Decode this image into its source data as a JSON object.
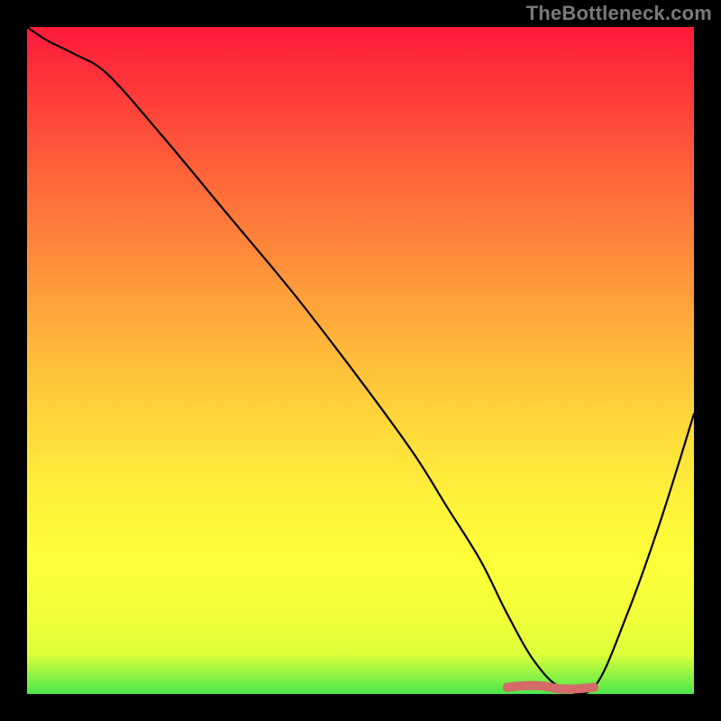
{
  "watermark": "TheBottleneck.com",
  "colors": {
    "background": "#000000",
    "gradient_top": "#ff1a3a",
    "gradient_bottom": "#49e84a",
    "curve": "#000000",
    "highlight": "#d46a6a",
    "watermark_text": "#7a7a7a"
  },
  "chart_data": {
    "type": "line",
    "title": "",
    "xlabel": "",
    "ylabel": "",
    "xlim": [
      0,
      100
    ],
    "ylim": [
      0,
      100
    ],
    "grid": false,
    "legend": null,
    "series": [
      {
        "name": "bottleneck-curve",
        "x": [
          0,
          3,
          7,
          12,
          20,
          30,
          40,
          50,
          58,
          63,
          68,
          72,
          76,
          80,
          85,
          90,
          95,
          100
        ],
        "values": [
          100,
          98,
          96,
          93,
          84,
          72,
          60,
          47,
          36,
          28,
          20,
          12,
          5,
          1,
          1,
          12,
          26,
          42
        ]
      }
    ],
    "annotations": [
      {
        "name": "optimal-range",
        "type": "segment",
        "x_start": 72,
        "x_end": 85,
        "y": 1
      }
    ]
  }
}
